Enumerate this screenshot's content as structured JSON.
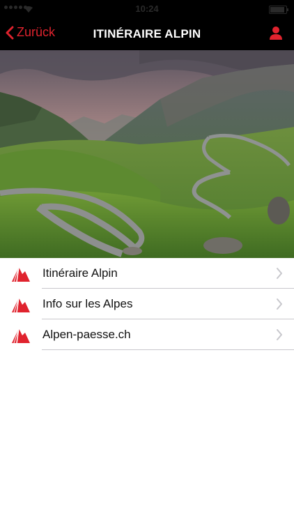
{
  "status_bar": {
    "time": "10:24"
  },
  "nav": {
    "back_label": "Zurück",
    "title": "ITINÉRAIRE ALPIN"
  },
  "hero": {
    "description": "mountain-serpentine-road-photo"
  },
  "menu": {
    "items": [
      {
        "label": "Itinéraire Alpin",
        "icon": "alps-logo-icon"
      },
      {
        "label": "Info sur les Alpes",
        "icon": "alps-logo-icon"
      },
      {
        "label": "Alpen-paesse.ch",
        "icon": "alps-logo-icon"
      }
    ]
  },
  "colors": {
    "accent": "#e0232e",
    "nav_background": "#000000",
    "separator": "#c8c7cc"
  }
}
